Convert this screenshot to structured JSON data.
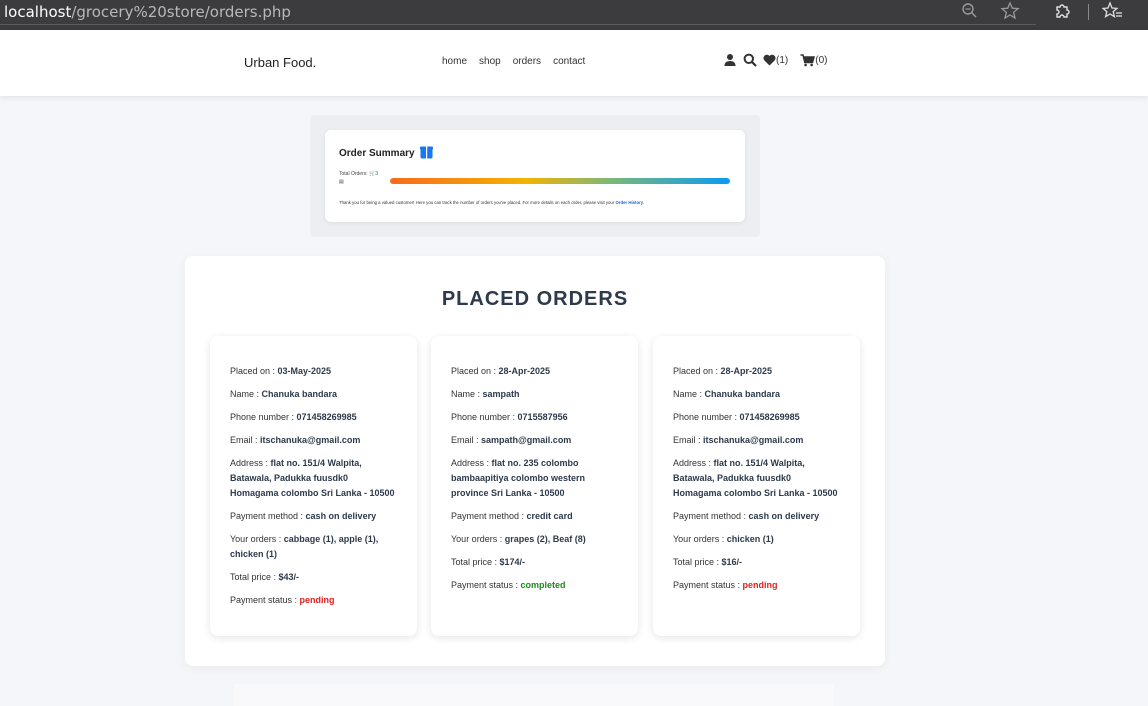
{
  "browser": {
    "url_host": "localhost",
    "url_path": "/grocery%20store/orders.php"
  },
  "header": {
    "logo": "Urban Food.",
    "nav": [
      "home",
      "shop",
      "orders",
      "contact"
    ],
    "wishlist_count": "(1)",
    "cart_count": "(0)"
  },
  "summary": {
    "title": "Order Summary",
    "total_label": "Total Orders:",
    "total_count": "3",
    "progress": 1.0,
    "note": "Thank you for being a valued customer! Here you can track the number of orders you've placed. For more details on each order, please visit your ",
    "note_link": "Order History",
    "note_end": "."
  },
  "orders_section": {
    "title": "PLACED ORDERS",
    "labels": {
      "placed_on": "Placed on : ",
      "name": "Name : ",
      "phone": "Phone number : ",
      "email": "Email : ",
      "address": "Address : ",
      "payment_method": "Payment method : ",
      "your_orders": "Your orders : ",
      "total_price": "Total price : ",
      "payment_status": "Payment status : "
    },
    "orders": [
      {
        "placed_on": "03-May-2025",
        "name": "Chanuka bandara",
        "phone": "071458269985",
        "email": "itschanuka@gmail.com",
        "address": "flat no. 151/4 Walpita, Batawala, Padukka fuusdk0 Homagama colombo Sri Lanka - 10500",
        "payment_method": "cash on delivery",
        "your_orders": "cabbage (1), apple (1), chicken (1)",
        "total_price": "$43/-",
        "payment_status": "pending"
      },
      {
        "placed_on": "28-Apr-2025",
        "name": "sampath",
        "phone": "0715587956",
        "email": "sampath@gmail.com",
        "address": "flat no. 235 colombo bambaapitiya colombo western province Sri Lanka - 10500",
        "payment_method": "credit card",
        "your_orders": "grapes (2), Beaf (8)",
        "total_price": "$174/-",
        "payment_status": "completed"
      },
      {
        "placed_on": "28-Apr-2025",
        "name": "Chanuka bandara",
        "phone": "071458269985",
        "email": "itschanuka@gmail.com",
        "address": "flat no. 151/4 Walpita, Batawala, Padukka fuusdk0 Homagama colombo Sri Lanka - 10500",
        "payment_method": "cash on delivery",
        "your_orders": "chicken (1)",
        "total_price": "$16/-",
        "payment_status": "pending"
      }
    ]
  },
  "icons": {
    "zoom": "zoom-out-icon",
    "bookmark": "star-icon",
    "extensions": "puzzle-icon",
    "favorites": "favorites-icon",
    "user": "user-icon",
    "search": "search-icon",
    "heart": "heart-icon",
    "cart": "cart-icon",
    "box": "box-icon"
  },
  "colors": {
    "pending": "#e02020",
    "completed": "#1e8a1e",
    "link": "#1665d8"
  }
}
